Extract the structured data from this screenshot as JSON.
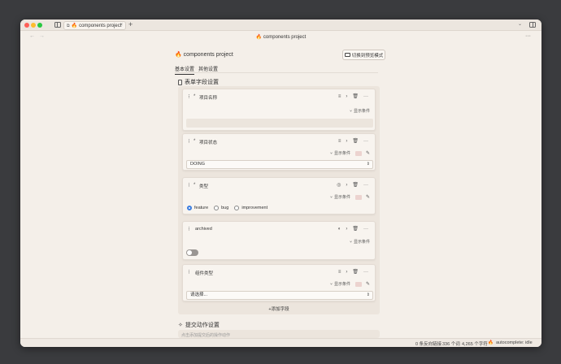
{
  "browser": {
    "tab_title": "components project",
    "tab_glyph": "⧉",
    "tab_close": "×",
    "new_tab": "+",
    "nav_back": "←",
    "nav_forward": "→",
    "doc_title": "components project",
    "more": "···",
    "chevron": "⌄"
  },
  "header": {
    "project_title": "components project",
    "switch_button": "切换到预览模式"
  },
  "tabs": [
    "基本设置",
    "其他设置"
  ],
  "sections": {
    "form_fields": "表单字段设置",
    "submit_actions": "提交动作设置",
    "submit_placeholder": "点击添加提交后的操作动作"
  },
  "common": {
    "show_condition": "显示条件",
    "drag": "⠇",
    "required": "*",
    "chevron": "›",
    "trash": "✖",
    "more": "···",
    "pencil": "✎",
    "tree": "⑂",
    "text_type": "≡",
    "select_arrow": "⇕"
  },
  "fields": [
    {
      "name": "项目名称",
      "type_icon": "text-icon",
      "control": "text"
    },
    {
      "name": "项目状态",
      "type_icon": "list-icon",
      "control": "select",
      "value": "DOING"
    },
    {
      "name": "类型",
      "type_icon": "radio-icon",
      "control": "radio",
      "options": [
        "feature",
        "bug",
        "improvement"
      ],
      "selected": "feature"
    },
    {
      "name": "archived",
      "type_icon": "toggle-icon",
      "control": "switch",
      "value": false
    },
    {
      "name": "组件类型",
      "type_icon": "list-icon",
      "control": "select",
      "placeholder": "请选择..."
    }
  ],
  "add_field": "+添加字段",
  "status": {
    "backlinks": "0 条反向链接",
    "words": "336 个词",
    "chars": "4,265 个字符",
    "autocomplete": "autocomplete: idle"
  },
  "colors": {
    "accent": "#3b7de0",
    "fire": "#e8702a",
    "panel": "#ece5dd"
  }
}
